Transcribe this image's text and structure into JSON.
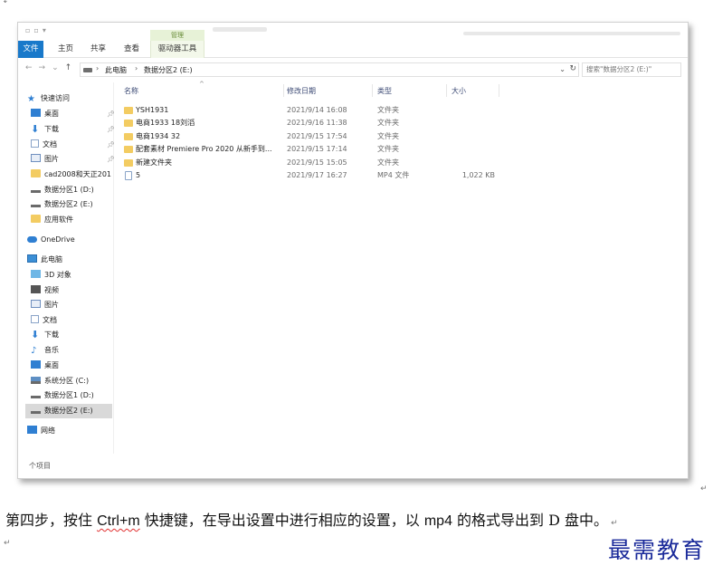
{
  "explorer": {
    "ribbon": {
      "file_tab": "文件",
      "home_tab": "主页",
      "share_tab": "共享",
      "view_tab": "查看",
      "manage_group": "管理",
      "drive_tools_tab": "驱动器工具"
    },
    "address": {
      "crumb_pc": "此电脑",
      "crumb_drive": "数据分区2 (E:)",
      "search_placeholder": "搜索\"数据分区2 (E:)\""
    },
    "nav_pane": {
      "quick_access": "快速访问",
      "desktop": "桌面",
      "downloads": "下载",
      "documents": "文档",
      "pictures": "图片",
      "cad_folder": "cad2008和天正201",
      "data_d": "数据分区1 (D:)",
      "data_e": "数据分区2 (E:)",
      "apps": "应用软件",
      "onedrive": "OneDrive",
      "this_pc": "此电脑",
      "objects_3d": "3D 对象",
      "videos": "视频",
      "pictures2": "图片",
      "documents2": "文档",
      "downloads2": "下载",
      "music": "音乐",
      "desktop2": "桌面",
      "system_c": "系统分区 (C:)",
      "data_d2": "数据分区1 (D:)",
      "data_e2": "数据分区2 (E:)",
      "network": "网络"
    },
    "columns": {
      "name": "名称",
      "date": "修改日期",
      "type": "类型",
      "size": "大小"
    },
    "files": [
      {
        "name": "YSH1931",
        "date": "2021/9/14 16:08",
        "type": "文件夹",
        "size": ""
      },
      {
        "name": "电商1933 18刘滔",
        "date": "2021/9/16 11:38",
        "type": "文件夹",
        "size": ""
      },
      {
        "name": "电商1934 32",
        "date": "2021/9/15 17:54",
        "type": "文件夹",
        "size": ""
      },
      {
        "name": "配套素材 Premiere Pro 2020 从新手到...",
        "date": "2021/9/15 17:14",
        "type": "文件夹",
        "size": ""
      },
      {
        "name": "新建文件夹",
        "date": "2021/9/15 15:05",
        "type": "文件夹",
        "size": ""
      },
      {
        "name": "5",
        "date": "2021/9/17 16:27",
        "type": "MP4 文件",
        "size": "1,022 KB"
      }
    ],
    "status": "个项目"
  },
  "document": {
    "para_prefix": "第四步，按住 ",
    "shortcut": "Ctrl+m",
    "para_middle": " 快捷键，在导出设置中进行相应的设置，以 ",
    "format": "mp4",
    "para_suffix": " 的格式导出到 D 盘中。",
    "watermark": "最需教育"
  }
}
